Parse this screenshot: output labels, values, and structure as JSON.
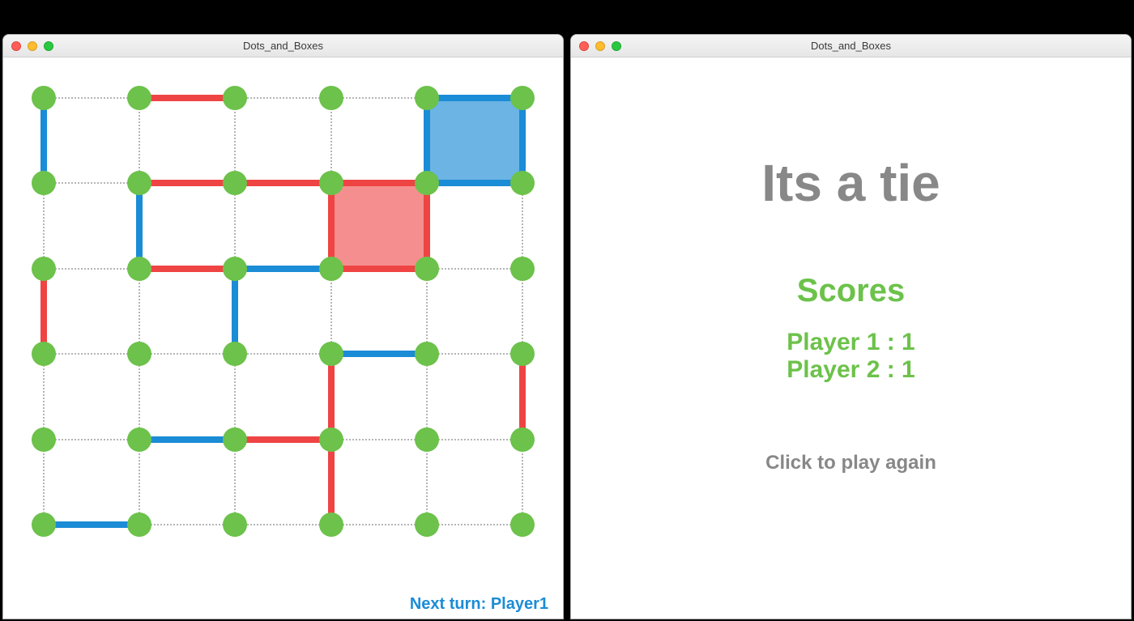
{
  "window_left": {
    "title": "Dots_and_Boxes",
    "next_turn_label": "Next turn: Player1"
  },
  "window_right": {
    "title": "Dots_and_Boxes",
    "result_title": "Its a tie",
    "scores_heading": "Scores",
    "player1_score_label": "Player 1 : 1",
    "player2_score_label": "Player 2 : 1",
    "play_again_label": "Click to play again"
  },
  "game": {
    "grid": {
      "rows": 6,
      "cols": 6
    },
    "players": {
      "p1": {
        "name": "Player1",
        "color": "#1b8cd6",
        "fill": "rgba(27,140,214,0.65)",
        "score": 1
      },
      "p2": {
        "name": "Player2",
        "color": "#ef4444",
        "fill": "rgba(239,68,68,0.6)",
        "score": 1
      }
    },
    "next_turn": "p1",
    "boxes": [
      {
        "row": 0,
        "col": 4,
        "owner": "p1"
      },
      {
        "row": 1,
        "col": 3,
        "owner": "p2"
      }
    ],
    "h_edges": [
      [
        "none",
        "p2",
        "none",
        "none",
        "p1",
        "p1"
      ],
      [
        "none",
        "p2",
        "p2",
        "p2",
        "p1",
        "none"
      ],
      [
        "none",
        "p2",
        "p1",
        "p2",
        "none",
        "none"
      ],
      [
        "none",
        "none",
        "none",
        "p1",
        "none",
        "none"
      ],
      [
        "none",
        "p1",
        "p2",
        "none",
        "none",
        "none"
      ],
      [
        "p1",
        "none",
        "none",
        "none",
        "none",
        "none"
      ]
    ],
    "v_edges": [
      [
        "p1",
        "none",
        "none",
        "none",
        "p1",
        "p1"
      ],
      [
        "none",
        "p1",
        "none",
        "p2",
        "p2",
        "none"
      ],
      [
        "p2",
        "none",
        "p1",
        "none",
        "none",
        "none"
      ],
      [
        "none",
        "none",
        "none",
        "p2",
        "none",
        "p2"
      ],
      [
        "none",
        "none",
        "none",
        "p2",
        "none",
        "none"
      ]
    ]
  },
  "colors": {
    "dot": "#6cc24a",
    "grid_dotted": "#b5b5b5",
    "status_text": "#888888"
  }
}
